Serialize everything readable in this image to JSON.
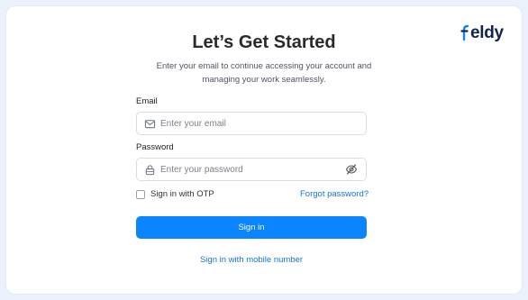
{
  "brand": {
    "logo_text": "eldy",
    "brand_color": "#0a84ff"
  },
  "header": {
    "title": "Let’s Get Started",
    "subtitle": "Enter your email to continue accessing your account and managing your work seamlessly."
  },
  "form": {
    "email_label": "Email",
    "email_placeholder": "Enter your email",
    "email_value": "",
    "password_label": "Password",
    "password_placeholder": "Enter your password",
    "password_value": "",
    "otp_label": "Sign in with OTP",
    "otp_checked": false,
    "forgot_label": "Forgot password?",
    "signin_label": "Sign in",
    "mobile_label": "Sign in with mobile number"
  },
  "icons": {
    "email": "mail-icon",
    "password": "lock-icon",
    "toggle": "eye-off-icon"
  },
  "colors": {
    "link": "#1574d6",
    "button": "#0a84ff",
    "background": "#eaf1fb"
  }
}
